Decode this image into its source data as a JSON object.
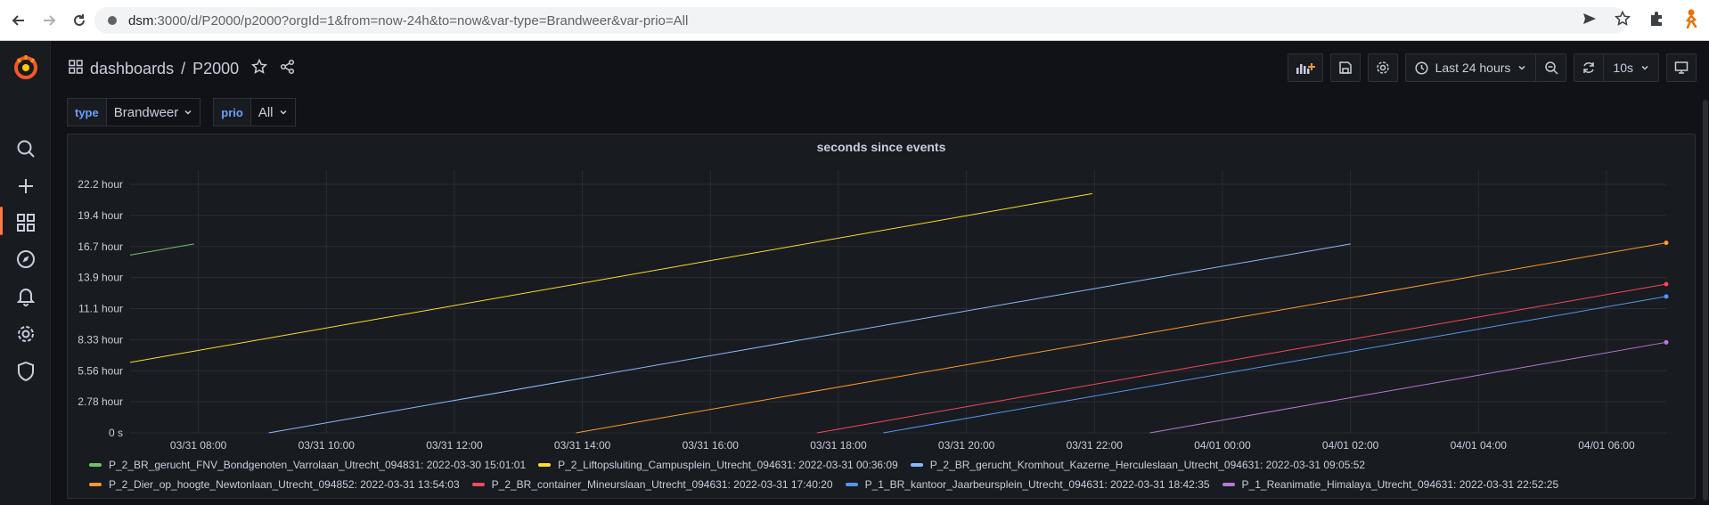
{
  "browser": {
    "url_host": "dsm",
    "url_rest": ":3000/d/P2000/p2000?orgId=1&from=now-24h&to=now&var-type=Brandweer&var-prio=All"
  },
  "breadcrumb": {
    "root": "dashboards",
    "separator": "/",
    "title": "P2000"
  },
  "toolbar": {
    "time_range": "Last 24 hours",
    "refresh": "10s"
  },
  "variables": [
    {
      "label": "type",
      "value": "Brandweer"
    },
    {
      "label": "prio",
      "value": "All"
    }
  ],
  "icons": {
    "sidebar": [
      "grafana-logo-icon",
      "search-icon",
      "plus-icon",
      "dashboards-icon",
      "explore-icon",
      "alerting-icon",
      "configuration-icon",
      "shield-icon"
    ]
  },
  "colors": {
    "accent": "#ff7941",
    "green": "#73bf69",
    "yellow": "#fade2a",
    "lightblue": "#8ab8ff",
    "orange": "#ff9830",
    "red": "#f2495c",
    "blue": "#5794f2",
    "purple": "#b877d9"
  },
  "chart_data": {
    "type": "line",
    "title": "seconds since events",
    "xlabel": "",
    "ylabel": "",
    "x_range": [
      "03/31 06:56",
      "04/01 06:56"
    ],
    "x_ticks": [
      "03/31 08:00",
      "03/31 10:00",
      "03/31 12:00",
      "03/31 14:00",
      "03/31 16:00",
      "03/31 18:00",
      "03/31 20:00",
      "03/31 22:00",
      "04/01 00:00",
      "04/01 02:00",
      "04/01 04:00",
      "04/01 06:00"
    ],
    "y_ticks": [
      "0 s",
      "2.78 hour",
      "5.56 hour",
      "8.33 hour",
      "11.1 hour",
      "13.9 hour",
      "16.7 hour",
      "19.4 hour",
      "22.2 hour"
    ],
    "ylim_hours": [
      0,
      23.5
    ],
    "grid": true,
    "legend": "bottom",
    "series": [
      {
        "name": "P_2_BR_gerucht_FNV_Bondgenoten_Varrolaan_Utrecht_094831: 2022-03-30 15:01:01",
        "color": "#73bf69",
        "x": [
          "03/31 06:56",
          "03/31 07:56"
        ],
        "y_hours": [
          15.9,
          16.9
        ]
      },
      {
        "name": "P_2_Liftopsluiting_Campusplein_Utrecht_094631: 2022-03-31 00:36:09",
        "color": "#fade2a",
        "x": [
          "03/31 06:56",
          "03/31 21:58"
        ],
        "y_hours": [
          6.3,
          21.4
        ]
      },
      {
        "name": "P_2_BR_gerucht_Kromhout_Kazerne_Herculeslaan_Utrecht_094631: 2022-03-31 09:05:52",
        "color": "#8ab8ff",
        "x": [
          "03/31 09:06",
          "04/01 02:00"
        ],
        "y_hours": [
          0,
          16.9
        ]
      },
      {
        "name": "P_2_Dier_op_hoogte_Newtonlaan_Utrecht_094852: 2022-03-31 13:54:03",
        "color": "#ff9830",
        "x": [
          "03/31 13:54",
          "04/01 06:56"
        ],
        "y_hours": [
          0,
          17.0
        ]
      },
      {
        "name": "P_2_BR_container_Mineurslaan_Utrecht_094631: 2022-03-31 17:40:20",
        "color": "#f2495c",
        "x": [
          "03/31 17:40",
          "04/01 06:56"
        ],
        "y_hours": [
          0,
          13.3
        ]
      },
      {
        "name": "P_1_BR_kantoor_Jaarbeursplein_Utrecht_094631: 2022-03-31 18:42:35",
        "color": "#5794f2",
        "x": [
          "03/31 18:42",
          "04/01 06:56"
        ],
        "y_hours": [
          0,
          12.2
        ]
      },
      {
        "name": "P_1_Reanimatie_Himalaya_Utrecht_094631: 2022-03-31 22:52:25",
        "color": "#b877d9",
        "x": [
          "03/31 22:52",
          "04/01 06:56"
        ],
        "y_hours": [
          0,
          8.1
        ]
      }
    ]
  }
}
